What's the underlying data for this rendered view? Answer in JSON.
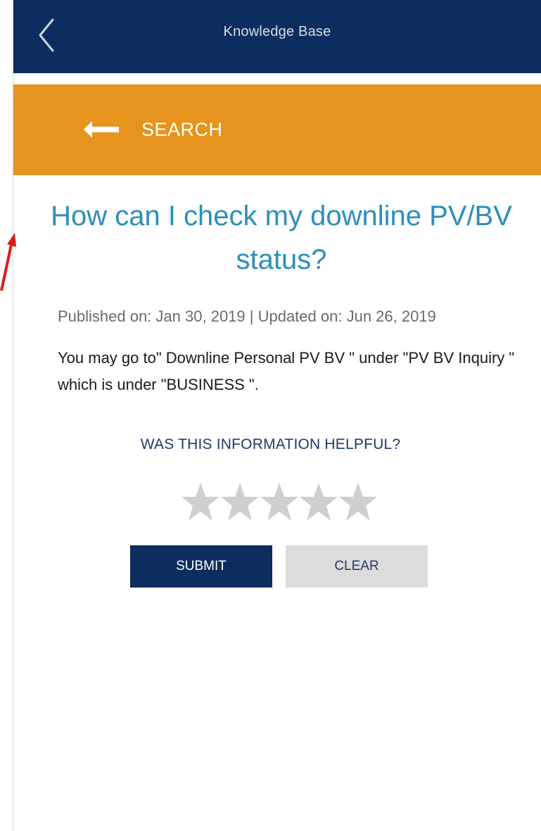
{
  "header": {
    "title": "Knowledge Base",
    "back_icon": "chevron-left-icon"
  },
  "search_bar": {
    "label": "SEARCH",
    "icon": "arrow-left-icon"
  },
  "article": {
    "title": "How can I check my downline PV/BV status?",
    "meta": "Published on: Jan 30, 2019 | Updated on: Jun 26, 2019",
    "body": "You may go to\" Downline Personal PV BV \" under \"PV BV Inquiry \" which is under \"BUSINESS \"."
  },
  "feedback": {
    "question": "WAS THIS INFORMATION HELPFUL?",
    "rating": 0,
    "max_rating": 5,
    "submit_label": "SUBMIT",
    "clear_label": "CLEAR"
  },
  "colors": {
    "header_bg": "#0c2d5f",
    "search_bg": "#e6941e",
    "title_color": "#2a8fba",
    "star_empty": "#cfcfcf",
    "annotation_arrow": "#e01a1a"
  }
}
